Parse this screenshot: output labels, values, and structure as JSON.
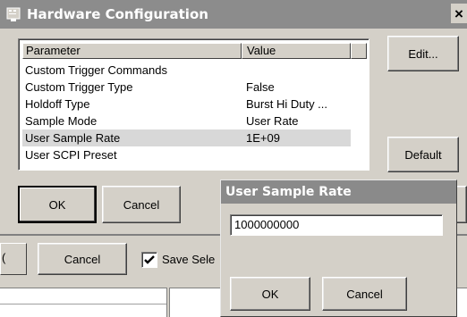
{
  "main_dialog": {
    "title": "Hardware Configuration",
    "close_glyph": "×",
    "table": {
      "columns": [
        "Parameter",
        "Value"
      ],
      "rows": [
        {
          "parameter": "Custom Trigger Commands",
          "value": ""
        },
        {
          "parameter": "Custom Trigger Type",
          "value": "False"
        },
        {
          "parameter": "Holdoff Type",
          "value": "Burst Hi Duty ..."
        },
        {
          "parameter": "Sample Mode",
          "value": "User Rate"
        },
        {
          "parameter": "User Sample Rate",
          "value": "1E+09",
          "selected": true
        },
        {
          "parameter": "User SCPI Preset",
          "value": ""
        }
      ]
    },
    "buttons": {
      "edit": "Edit...",
      "default": "Default",
      "ok": "OK",
      "cancel": "Cancel"
    }
  },
  "background_window": {
    "cancel_label": "Cancel",
    "checkbox": {
      "label": "Save Sele",
      "checked": true
    },
    "left_stub": "("
  },
  "popup": {
    "title": "User Sample Rate",
    "input_value": "1000000000",
    "ok_label": "OK",
    "cancel_label": "Cancel"
  },
  "colors": {
    "titlebar_main": "#8c8c8c",
    "titlebar_popup": "#8a8a8a",
    "dialog_face": "#d4d0c8",
    "selection": "#d8d8d8"
  },
  "icons": {
    "app": "hardware-config-icon",
    "close": "close-icon",
    "check": "checkmark-icon"
  }
}
